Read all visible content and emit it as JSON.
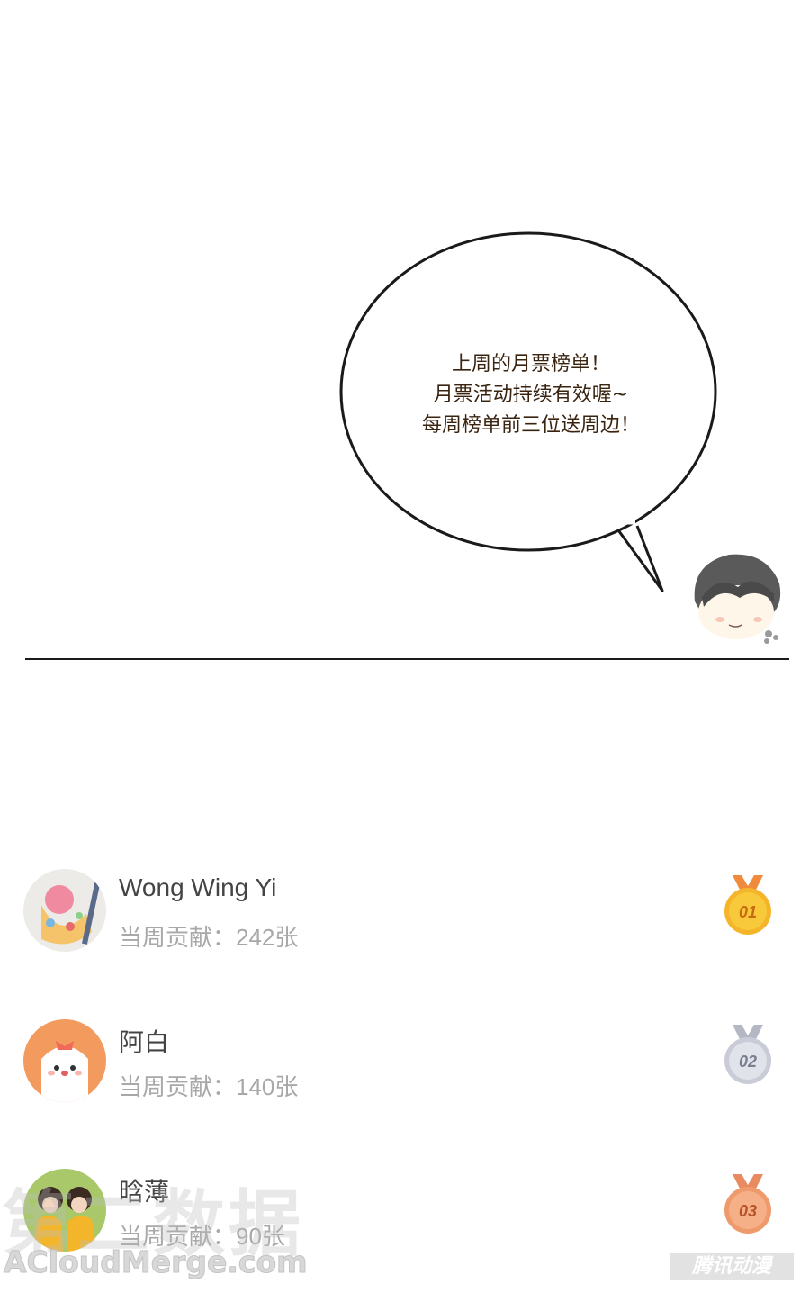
{
  "bubble": {
    "lines": [
      "上周的月票榜单！",
      "月票活动持续有效喔~",
      "每周榜单前三位送周边！"
    ]
  },
  "ranking": [
    {
      "name": "Wong Wing Yi",
      "contribution_label": "当周贡献：",
      "contribution_value": "242张",
      "medal": "01",
      "medal_color": "#f5b52a",
      "ribbon_color": "#f08a3c"
    },
    {
      "name": "阿白",
      "contribution_label": "当周贡献：",
      "contribution_value": "140张",
      "medal": "02",
      "medal_color": "#c9ccd6",
      "ribbon_color": "#b4b8c4"
    },
    {
      "name": "晗薄",
      "contribution_label": "当周贡献：",
      "contribution_value": "90张",
      "medal": "03",
      "medal_color": "#ef9a6c",
      "ribbon_color": "#e98a60"
    }
  ],
  "watermarks": {
    "zh": "第二数据",
    "en": "ACloudMerge.com",
    "corner": "腾讯动漫"
  }
}
